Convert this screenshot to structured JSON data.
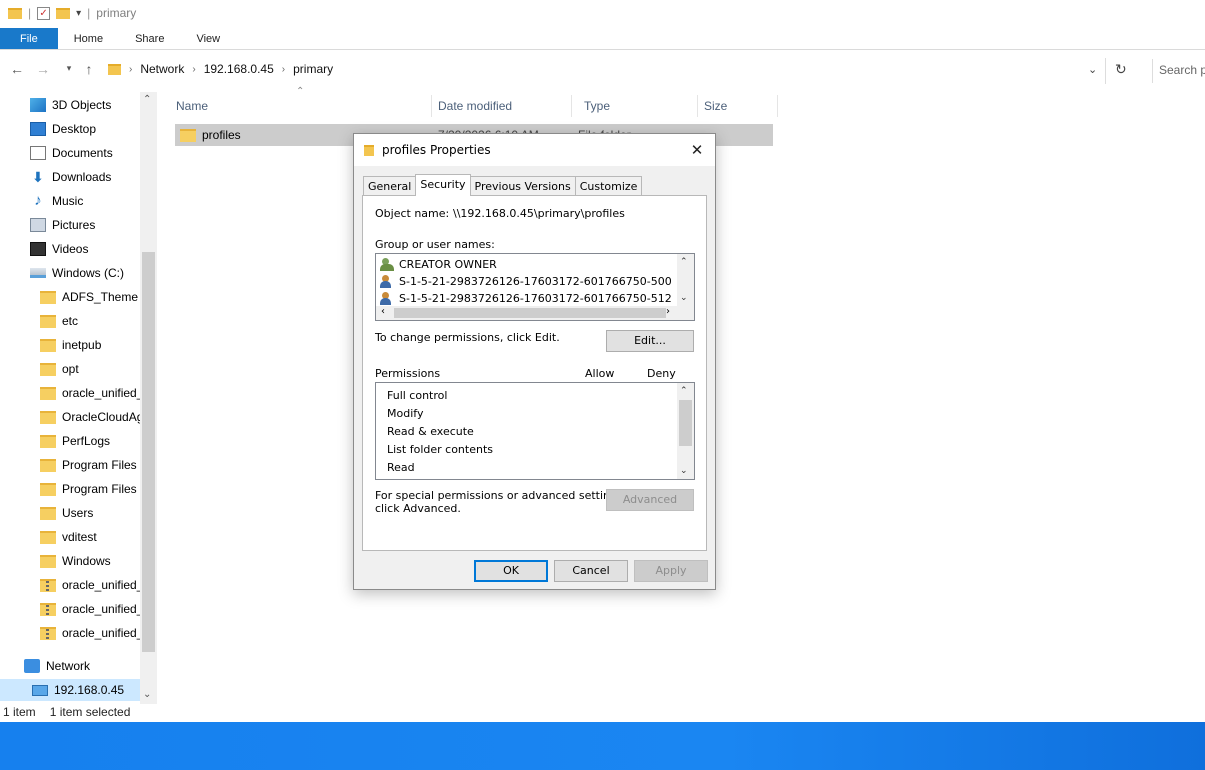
{
  "window": {
    "title": "primary"
  },
  "ribbon": {
    "tabs": [
      "File",
      "Home",
      "Share",
      "View"
    ]
  },
  "address": {
    "crumbs": [
      "Network",
      "192.168.0.45",
      "primary"
    ],
    "search_placeholder": "Search p"
  },
  "nav": {
    "items": [
      {
        "label": "3D Objects",
        "icon": "3d-objects-icon"
      },
      {
        "label": "Desktop",
        "icon": "desktop-icon"
      },
      {
        "label": "Documents",
        "icon": "documents-icon"
      },
      {
        "label": "Downloads",
        "icon": "downloads-icon"
      },
      {
        "label": "Music",
        "icon": "music-icon"
      },
      {
        "label": "Pictures",
        "icon": "pictures-icon"
      },
      {
        "label": "Videos",
        "icon": "videos-icon"
      },
      {
        "label": "Windows (C:)",
        "icon": "drive-icon"
      },
      {
        "label": "ADFS_Theme",
        "icon": "folder-icon"
      },
      {
        "label": "etc",
        "icon": "folder-icon"
      },
      {
        "label": "inetpub",
        "icon": "folder-icon"
      },
      {
        "label": "opt",
        "icon": "folder-icon"
      },
      {
        "label": "oracle_unified_",
        "icon": "folder-icon"
      },
      {
        "label": "OracleCloudAg",
        "icon": "folder-icon"
      },
      {
        "label": "PerfLogs",
        "icon": "folder-icon"
      },
      {
        "label": "Program Files",
        "icon": "folder-icon"
      },
      {
        "label": "Program Files (",
        "icon": "folder-icon"
      },
      {
        "label": "Users",
        "icon": "folder-icon"
      },
      {
        "label": "vditest",
        "icon": "folder-icon"
      },
      {
        "label": "Windows",
        "icon": "folder-icon"
      },
      {
        "label": "oracle_unified_",
        "icon": "zip-icon"
      },
      {
        "label": "oracle_unified_",
        "icon": "zip-icon"
      },
      {
        "label": "oracle_unified_",
        "icon": "zip-icon"
      },
      {
        "label": "Network",
        "icon": "network-icon"
      },
      {
        "label": "192.168.0.45",
        "icon": "computer-icon"
      }
    ]
  },
  "columns": {
    "name": "Name",
    "date": "Date modified",
    "type": "Type",
    "size": "Size"
  },
  "files": [
    {
      "name": "profiles",
      "date": "7/20/2026 6:10 AM",
      "type": "File folder"
    }
  ],
  "status": {
    "count": "1 item",
    "selected": "1 item selected"
  },
  "dialog": {
    "title": "profiles Properties",
    "tabs": [
      "General",
      "Security",
      "Previous Versions",
      "Customize"
    ],
    "object_label": "Object name:",
    "object_value": "\\\\192.168.0.45\\primary\\profiles",
    "group_label": "Group or user names:",
    "users": [
      {
        "name": "CREATOR OWNER",
        "kind": "group"
      },
      {
        "name": "S-1-5-21-2983726126-17603172-601766750-500",
        "kind": "unknown"
      },
      {
        "name": "S-1-5-21-2983726126-17603172-601766750-512",
        "kind": "unknown"
      }
    ],
    "change_text": "To change permissions, click Edit.",
    "edit_button": "Edit...",
    "perm_header": "Permissions",
    "allow_header": "Allow",
    "deny_header": "Deny",
    "permissions": [
      "Full control",
      "Modify",
      "Read & execute",
      "List folder contents",
      "Read"
    ],
    "special_text_1": "For special permissions or advanced settings,",
    "special_text_2": "click Advanced.",
    "advanced_button": "Advanced",
    "ok_button": "OK",
    "cancel_button": "Cancel",
    "apply_button": "Apply"
  },
  "colors": {
    "file_tab": "#1979ca",
    "selection": "#cce8ff",
    "taskbar": "#1680ee",
    "default_button": "#0078d7"
  }
}
